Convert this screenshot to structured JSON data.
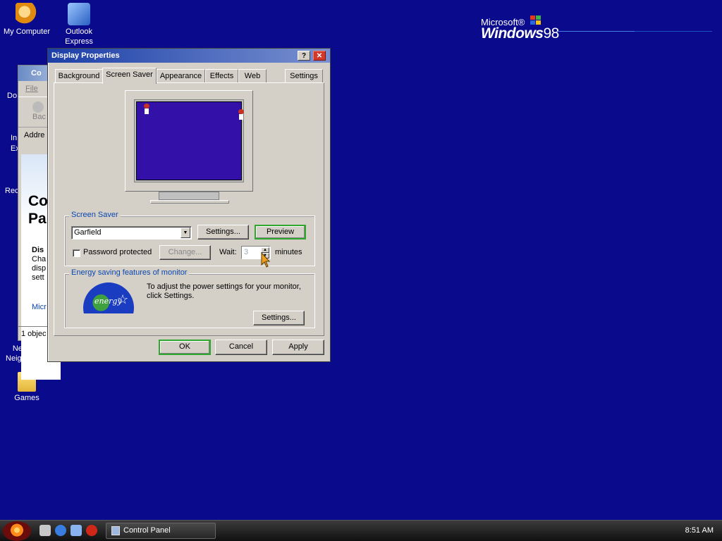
{
  "desktop": {
    "icons": [
      {
        "label": "My Computer",
        "glyph": "garfield-computer-icon"
      },
      {
        "label": "Outlook Express",
        "glyph": "outlook-express-icon"
      },
      {
        "label": "Network Neighborh...",
        "glyph": "network-icon"
      },
      {
        "label": "Games",
        "glyph": "folder-icon"
      }
    ],
    "partial_labels": [
      "Do",
      "In",
      "Ex",
      "Rec"
    ],
    "logo": {
      "microsoft": "Microsoft®",
      "windows": "Windows",
      "version": "98"
    }
  },
  "bg_window": {
    "title": "Co",
    "menu": "File",
    "back": "Bac",
    "address": "Addre",
    "heading": "Co Pa",
    "heading_line1": "Co",
    "heading_line2": "Pa",
    "desc_title": "Dis",
    "desc_lines": [
      "Cha",
      "disp",
      "sett"
    ],
    "link": "Micr",
    "status": "1 objec"
  },
  "dialog": {
    "title": "Display Properties",
    "title_buttons": [
      "?",
      "✕"
    ],
    "tabs": [
      "Background",
      "Screen Saver",
      "Appearance",
      "Effects",
      "Web",
      "Settings"
    ],
    "active_tab": "Screen Saver",
    "screen_saver": {
      "group_label": "Screen Saver",
      "selected": "Garfield",
      "settings_button": "Settings...",
      "preview_button": "Preview",
      "password_label": "Password protected",
      "password_checked": false,
      "change_button": "Change...",
      "wait_label": "Wait:",
      "wait_value": "3",
      "minutes_label": "minutes"
    },
    "energy": {
      "group_label": "Energy saving features of monitor",
      "text": "To adjust the power settings for your monitor, click Settings.",
      "logo_text": "energy",
      "settings_button": "Settings..."
    },
    "buttons": {
      "ok": "OK",
      "cancel": "Cancel",
      "apply": "Apply"
    }
  },
  "taskbar": {
    "task_label": "Control Panel",
    "clock": "8:51 AM",
    "quicklaunch": [
      "desktop-icon",
      "ie-icon",
      "outlook-icon",
      "media-icon"
    ]
  },
  "colors": {
    "desktop": "#0a0a8c",
    "accent_focus": "#2fa82f",
    "group_label": "#0a46b0",
    "preview_screen": "#3311a8"
  }
}
